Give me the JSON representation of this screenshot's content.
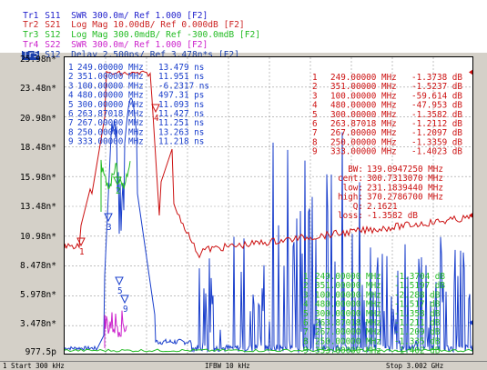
{
  "traces": [
    {
      "tag": "Tr1",
      "text": "S11  SWR 300.0m/ Ref 1.000 [F2]",
      "color": "#2222cc",
      "active": false
    },
    {
      "tag": "Tr2",
      "text": "S21  Log Mag 10.00dB/ Ref 0.000dB [F2]",
      "color": "#cc2222",
      "active": false
    },
    {
      "tag": "Tr3",
      "text": "S12  Log Mag 300.0mdB/ Ref -300.0mdB [F2]",
      "color": "#22bb22",
      "active": false
    },
    {
      "tag": "Tr4",
      "text": "S22  SWR 300.0m/ Ref 1.000 [F2]",
      "color": "#cc22cc",
      "active": false
    },
    {
      "tag": "Tr5",
      "text": "S12  Delay 2.500ps/ Ref 3.478n*s [F2]",
      "color": "#1a3faa",
      "active": true
    }
  ],
  "y_labels": [
    "25.98n*",
    "23.48n*",
    "20.98n*",
    "18.48n*",
    "15.98n*",
    "13.48n*",
    "10.98n*",
    "8.478n*",
    "5.978n*",
    "3.478n*",
    "977.5p"
  ],
  "marker_table_blue": [
    {
      "n": "1",
      "freq": "249.00000 MHz",
      "val": "13.479 ns"
    },
    {
      "n": "2",
      "freq": "351.00000 MHz",
      "val": "11.951 ns"
    },
    {
      "n": "3",
      "freq": "100.00000 MHz",
      "val": "-6.2317 ns"
    },
    {
      "n": "4",
      "freq": "480.00000 MHz",
      "val": "497.31 ps"
    },
    {
      "n": "5",
      "freq": "300.00000 MHz",
      "val": "11.093 ns"
    },
    {
      "n": "6",
      "freq": "263.87018 MHz",
      "val": "11.427 ns"
    },
    {
      "n": "7",
      "freq": "267.00000 MHz",
      "val": "11.251 ns"
    },
    {
      "n": "8",
      "freq": "250.00000 MHz",
      "val": "13.263 ns"
    },
    {
      "n": "9",
      "freq": "333.00000 MHz",
      "val": "11.218 ns"
    }
  ],
  "marker_table_red": [
    {
      "n": "1",
      "freq": "249.00000 MHz",
      "val": "-1.3738 dB"
    },
    {
      "n": "2",
      "freq": "351.00000 MHz",
      "val": "-1.5237 dB"
    },
    {
      "n": "3",
      "freq": "100.00000 MHz",
      "val": "-59.614 dB"
    },
    {
      "n": "4",
      "freq": "480.00000 MHz",
      "val": "-47.953 dB"
    },
    {
      "n": "5",
      "freq": "300.00000 MHz",
      "val": "-1.3582 dB"
    },
    {
      "n": "6",
      "freq": "263.87018 MHz",
      "val": "-1.2112 dB"
    },
    {
      "n": "7",
      "freq": "267.00000 MHz",
      "val": "-1.2097 dB"
    },
    {
      "n": "8",
      "freq": "250.00000 MHz",
      "val": "-1.3359 dB"
    },
    {
      "n": "9",
      "freq": "333.00000 MHz",
      "val": "-1.4023 dB"
    }
  ],
  "bw_stats": [
    {
      "k": "BW:",
      "v": "139.0947250 MHz"
    },
    {
      "k": "cent:",
      "v": "300.7313070 MHz"
    },
    {
      "k": "low:",
      "v": "231.1839440 MHz"
    },
    {
      "k": "high:",
      "v": "370.2786700 MHz"
    },
    {
      "k": "Q:",
      "v": "2.1621"
    },
    {
      "k": "loss:",
      "v": "-1.3582 dB"
    }
  ],
  "marker_table_green": [
    {
      "n": "1",
      "freq": "249.00000 MHz",
      "val": "-1.3704 dB"
    },
    {
      "n": "2",
      "freq": "351.00000 MHz",
      "val": "-1.5197 dB"
    },
    {
      "n": "3",
      "freq": "100.00000 MHz",
      "val": "-2.288 dB"
    },
    {
      "n": "4",
      "freq": "480.00000 MHz",
      "val": "-1.517 dB"
    },
    {
      "n": "5",
      "freq": "300.00000 MHz",
      "val": "-1.358 dB"
    },
    {
      "n": "6",
      "freq": "263.87018 MHz",
      "val": "-1.211 dB"
    },
    {
      "n": "7",
      "freq": "267.00000 MHz",
      "val": "-1.209 dB"
    },
    {
      "n": "8",
      "freq": "250.00000 MHz",
      "val": "-1.335 dB"
    },
    {
      "n": "9",
      "freq": "333.00000 MHz",
      "val": "-1.402 dB"
    }
  ],
  "status": {
    "start": "1 Start 300 kHz",
    "ifbw": "IFBW 10 kHz",
    "stop": "Stop 3.002 GHz"
  },
  "colors": {
    "blue": "#1a3fcc",
    "red": "#cc1111",
    "green": "#22bb22",
    "magenta": "#cc22cc",
    "grid": "#999999"
  }
}
